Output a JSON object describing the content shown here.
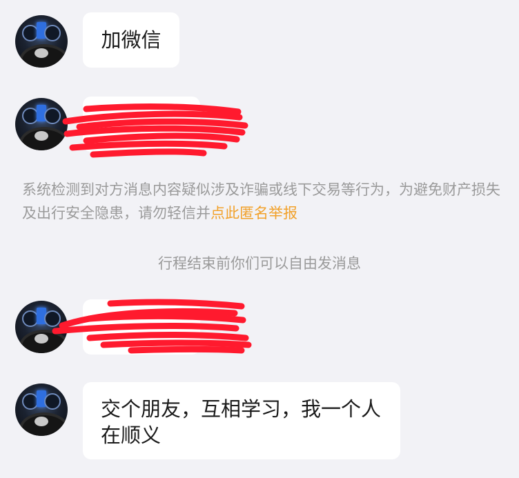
{
  "messages": [
    {
      "text": "加微信"
    },
    {
      "text": "",
      "redacted": true
    },
    {
      "text": "",
      "redacted": true
    },
    {
      "text": "交个朋友，互相学习，我一个人在顺义"
    }
  ],
  "system_notice": {
    "text": "系统检测到对方消息内容疑似涉及诈骗或线下交易等行为，为避免财产损失及出行安全隐患，请勿轻信并",
    "link_text": "点此匿名举报"
  },
  "status_note": "行程结束前你们可以自由发消息",
  "colors": {
    "background": "#f2f2f6",
    "bubble": "#ffffff",
    "link": "#f2a12a",
    "redaction": "#ff1a2e"
  }
}
